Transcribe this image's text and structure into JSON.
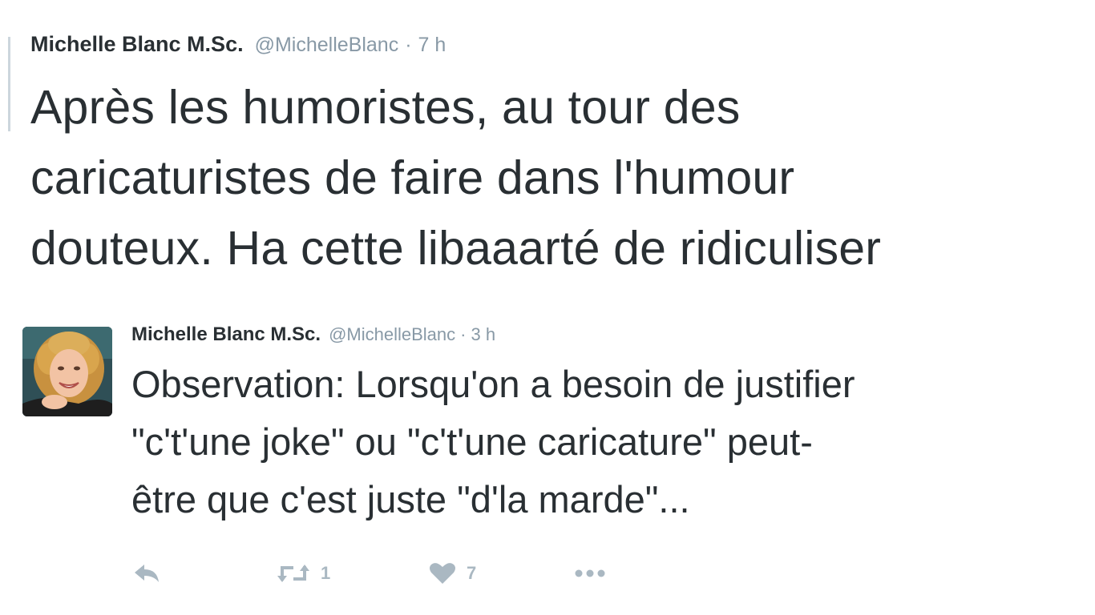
{
  "tweet_main": {
    "author_name": "Michelle Blanc M.Sc.",
    "handle": "@MichelleBlanc",
    "separator": "·",
    "time": "7 h",
    "text_lines": [
      "Après les humoristes, au tour des",
      "caricaturistes de faire dans l'humour",
      "douteux. Ha cette libaaarté de ridiculiser"
    ]
  },
  "tweet_quoted": {
    "author_name": "Michelle Blanc M.Sc.",
    "handle": "@MichelleBlanc",
    "separator": "·",
    "time": "3 h",
    "text_lines": [
      "Observation: Lorsqu'on a besoin de justifier",
      "\"c't'une joke\" ou \"c't'une caricature\" peut-",
      "être que c'est juste \"d'la marde\"..."
    ],
    "actions": {
      "reply_icon": "reply-icon",
      "retweet_icon": "retweet-icon",
      "retweet_count": "1",
      "like_icon": "heart-icon",
      "like_count": "7",
      "more_icon": "more-icon"
    }
  },
  "colors": {
    "text": "#292f33",
    "muted": "#8899a6",
    "icon": "#aab8c2"
  }
}
